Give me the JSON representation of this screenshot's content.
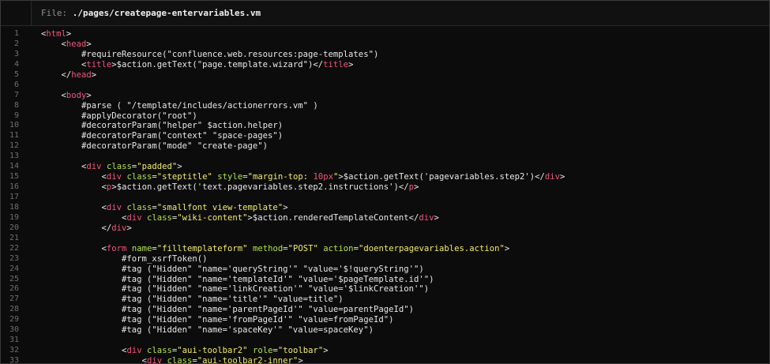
{
  "header": {
    "file_label": "File:",
    "file_path": "./pages/createpage-entervariables.vm"
  },
  "code_lines": [
    {
      "n": "1",
      "segs": [
        {
          "t": "<",
          "c": "ws"
        },
        {
          "t": "html",
          "c": "tag"
        },
        {
          "t": ">",
          "c": "ws"
        }
      ]
    },
    {
      "n": "2",
      "segs": [
        {
          "t": "    <",
          "c": "ws"
        },
        {
          "t": "head",
          "c": "tag"
        },
        {
          "t": ">",
          "c": "ws"
        }
      ]
    },
    {
      "n": "3",
      "segs": [
        {
          "t": "        #requireResource(\"confluence.web.resources:page-templates\")",
          "c": "ws"
        }
      ]
    },
    {
      "n": "4",
      "segs": [
        {
          "t": "        <",
          "c": "ws"
        },
        {
          "t": "title",
          "c": "tag"
        },
        {
          "t": ">$action.getText(\"page.template.wizard\")</",
          "c": "ws"
        },
        {
          "t": "title",
          "c": "tag"
        },
        {
          "t": ">",
          "c": "ws"
        }
      ]
    },
    {
      "n": "5",
      "segs": [
        {
          "t": "    </",
          "c": "ws"
        },
        {
          "t": "head",
          "c": "tag"
        },
        {
          "t": ">",
          "c": "ws"
        }
      ]
    },
    {
      "n": "6",
      "segs": []
    },
    {
      "n": "7",
      "segs": [
        {
          "t": "    <",
          "c": "ws"
        },
        {
          "t": "body",
          "c": "tag"
        },
        {
          "t": ">",
          "c": "ws"
        }
      ]
    },
    {
      "n": "8",
      "segs": [
        {
          "t": "        #parse ( \"/template/includes/actionerrors.vm\" )",
          "c": "ws"
        }
      ]
    },
    {
      "n": "9",
      "segs": [
        {
          "t": "        #applyDecorator(\"root\")",
          "c": "ws"
        }
      ]
    },
    {
      "n": "10",
      "segs": [
        {
          "t": "        #decoratorParam(\"helper\" $action.helper)",
          "c": "ws"
        }
      ]
    },
    {
      "n": "11",
      "segs": [
        {
          "t": "        #decoratorParam(\"context\" \"space-pages\")",
          "c": "ws"
        }
      ]
    },
    {
      "n": "12",
      "segs": [
        {
          "t": "        #decoratorParam(\"mode\" \"create-page\")",
          "c": "ws"
        }
      ]
    },
    {
      "n": "13",
      "segs": []
    },
    {
      "n": "14",
      "segs": [
        {
          "t": "        <",
          "c": "ws"
        },
        {
          "t": "div",
          "c": "tag"
        },
        {
          "t": " ",
          "c": "ws"
        },
        {
          "t": "class",
          "c": "attr"
        },
        {
          "t": "=",
          "c": "ws"
        },
        {
          "t": "\"padded\"",
          "c": "str"
        },
        {
          "t": ">",
          "c": "ws"
        }
      ]
    },
    {
      "n": "15",
      "segs": [
        {
          "t": "            <",
          "c": "ws"
        },
        {
          "t": "div",
          "c": "tag"
        },
        {
          "t": " ",
          "c": "ws"
        },
        {
          "t": "class",
          "c": "attr"
        },
        {
          "t": "=",
          "c": "ws"
        },
        {
          "t": "\"steptitle\"",
          "c": "str"
        },
        {
          "t": " ",
          "c": "ws"
        },
        {
          "t": "style",
          "c": "attr"
        },
        {
          "t": "=",
          "c": "ws"
        },
        {
          "t": "\"margin-top: ",
          "c": "str"
        },
        {
          "t": "10px",
          "c": "tag"
        },
        {
          "t": "\"",
          "c": "str"
        },
        {
          "t": ">$action.getText('pagevariables.step2')</",
          "c": "ws"
        },
        {
          "t": "div",
          "c": "tag"
        },
        {
          "t": ">",
          "c": "ws"
        }
      ]
    },
    {
      "n": "16",
      "segs": [
        {
          "t": "            <",
          "c": "ws"
        },
        {
          "t": "p",
          "c": "tag"
        },
        {
          "t": ">$action.getText('text.pagevariables.step2.instructions')</",
          "c": "ws"
        },
        {
          "t": "p",
          "c": "tag"
        },
        {
          "t": ">",
          "c": "ws"
        }
      ]
    },
    {
      "n": "17",
      "segs": []
    },
    {
      "n": "18",
      "segs": [
        {
          "t": "            <",
          "c": "ws"
        },
        {
          "t": "div",
          "c": "tag"
        },
        {
          "t": " ",
          "c": "ws"
        },
        {
          "t": "class",
          "c": "attr"
        },
        {
          "t": "=",
          "c": "ws"
        },
        {
          "t": "\"smallfont view-template\"",
          "c": "str"
        },
        {
          "t": ">",
          "c": "ws"
        }
      ]
    },
    {
      "n": "19",
      "segs": [
        {
          "t": "                <",
          "c": "ws"
        },
        {
          "t": "div",
          "c": "tag"
        },
        {
          "t": " ",
          "c": "ws"
        },
        {
          "t": "class",
          "c": "attr"
        },
        {
          "t": "=",
          "c": "ws"
        },
        {
          "t": "\"wiki-content\"",
          "c": "str"
        },
        {
          "t": ">$action.renderedTemplateContent</",
          "c": "ws"
        },
        {
          "t": "div",
          "c": "tag"
        },
        {
          "t": ">",
          "c": "ws"
        }
      ]
    },
    {
      "n": "20",
      "segs": [
        {
          "t": "            </",
          "c": "ws"
        },
        {
          "t": "div",
          "c": "tag"
        },
        {
          "t": ">",
          "c": "ws"
        }
      ]
    },
    {
      "n": "21",
      "segs": []
    },
    {
      "n": "22",
      "segs": [
        {
          "t": "            <",
          "c": "ws"
        },
        {
          "t": "form",
          "c": "tag"
        },
        {
          "t": " ",
          "c": "ws"
        },
        {
          "t": "name",
          "c": "attr"
        },
        {
          "t": "=",
          "c": "ws"
        },
        {
          "t": "\"filltemplateform\"",
          "c": "str"
        },
        {
          "t": " ",
          "c": "ws"
        },
        {
          "t": "method",
          "c": "attr"
        },
        {
          "t": "=",
          "c": "ws"
        },
        {
          "t": "\"POST\"",
          "c": "str"
        },
        {
          "t": " ",
          "c": "ws"
        },
        {
          "t": "action",
          "c": "attr"
        },
        {
          "t": "=",
          "c": "ws"
        },
        {
          "t": "\"doenterpagevariables.action\"",
          "c": "str"
        },
        {
          "t": ">",
          "c": "ws"
        }
      ]
    },
    {
      "n": "23",
      "segs": [
        {
          "t": "                #form_xsrfToken()",
          "c": "ws"
        }
      ]
    },
    {
      "n": "24",
      "segs": [
        {
          "t": "                #tag (\"Hidden\" \"name='queryString'\" \"value='$!queryString'\")",
          "c": "ws"
        }
      ]
    },
    {
      "n": "25",
      "segs": [
        {
          "t": "                #tag (\"Hidden\" \"name='templateId'\" \"value='$pageTemplate.id'\")",
          "c": "ws"
        }
      ]
    },
    {
      "n": "26",
      "segs": [
        {
          "t": "                #tag (\"Hidden\" \"name='linkCreation'\" \"value='$linkCreation'\")",
          "c": "ws"
        }
      ]
    },
    {
      "n": "27",
      "segs": [
        {
          "t": "                #tag (\"Hidden\" \"name='title'\" \"value=title\")",
          "c": "ws"
        }
      ]
    },
    {
      "n": "28",
      "segs": [
        {
          "t": "                #tag (\"Hidden\" \"name='parentPageId'\" \"value=parentPageId\")",
          "c": "ws"
        }
      ]
    },
    {
      "n": "29",
      "segs": [
        {
          "t": "                #tag (\"Hidden\" \"name='fromPageId'\" \"value=fromPageId\")",
          "c": "ws"
        }
      ]
    },
    {
      "n": "30",
      "segs": [
        {
          "t": "                #tag (\"Hidden\" \"name='spaceKey'\" \"value=spaceKey\")",
          "c": "ws"
        }
      ]
    },
    {
      "n": "31",
      "segs": []
    },
    {
      "n": "32",
      "segs": [
        {
          "t": "                <",
          "c": "ws"
        },
        {
          "t": "div",
          "c": "tag"
        },
        {
          "t": " ",
          "c": "ws"
        },
        {
          "t": "class",
          "c": "attr"
        },
        {
          "t": "=",
          "c": "ws"
        },
        {
          "t": "\"aui-toolbar2\"",
          "c": "str"
        },
        {
          "t": " ",
          "c": "ws"
        },
        {
          "t": "role",
          "c": "attr"
        },
        {
          "t": "=",
          "c": "ws"
        },
        {
          "t": "\"toolbar\"",
          "c": "str"
        },
        {
          "t": ">",
          "c": "ws"
        }
      ]
    },
    {
      "n": "33",
      "segs": [
        {
          "t": "                    <",
          "c": "ws"
        },
        {
          "t": "div",
          "c": "tag"
        },
        {
          "t": " ",
          "c": "ws"
        },
        {
          "t": "class",
          "c": "attr"
        },
        {
          "t": "=",
          "c": "ws"
        },
        {
          "t": "\"aui-toolbar2-inner\"",
          "c": "str"
        },
        {
          "t": ">",
          "c": "ws"
        }
      ]
    }
  ]
}
